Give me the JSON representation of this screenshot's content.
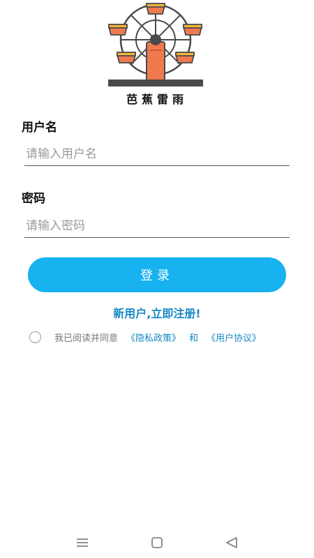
{
  "app": {
    "name": "芭蕉雷雨",
    "logo": "ferris-wheel-logo"
  },
  "username": {
    "label": "用户名",
    "placeholder": "请输入用户名",
    "value": ""
  },
  "password": {
    "label": "密码",
    "placeholder": "请输入密码",
    "value": ""
  },
  "login_button": "登录",
  "register_link": "新用户,立即注册!",
  "agreement": {
    "checked": false,
    "text": "我已阅读并同意",
    "privacy_link": "《隐私政策》",
    "and": "和",
    "terms_link": "《用户协议》"
  },
  "navbar": {
    "menu_icon": "menu-icon",
    "home_icon": "home-icon",
    "back_icon": "back-icon"
  },
  "colors": {
    "accent": "#17b2ef",
    "link": "#1788c4",
    "logo_orange": "#f07a4f",
    "logo_dark": "#4a4a4a"
  }
}
